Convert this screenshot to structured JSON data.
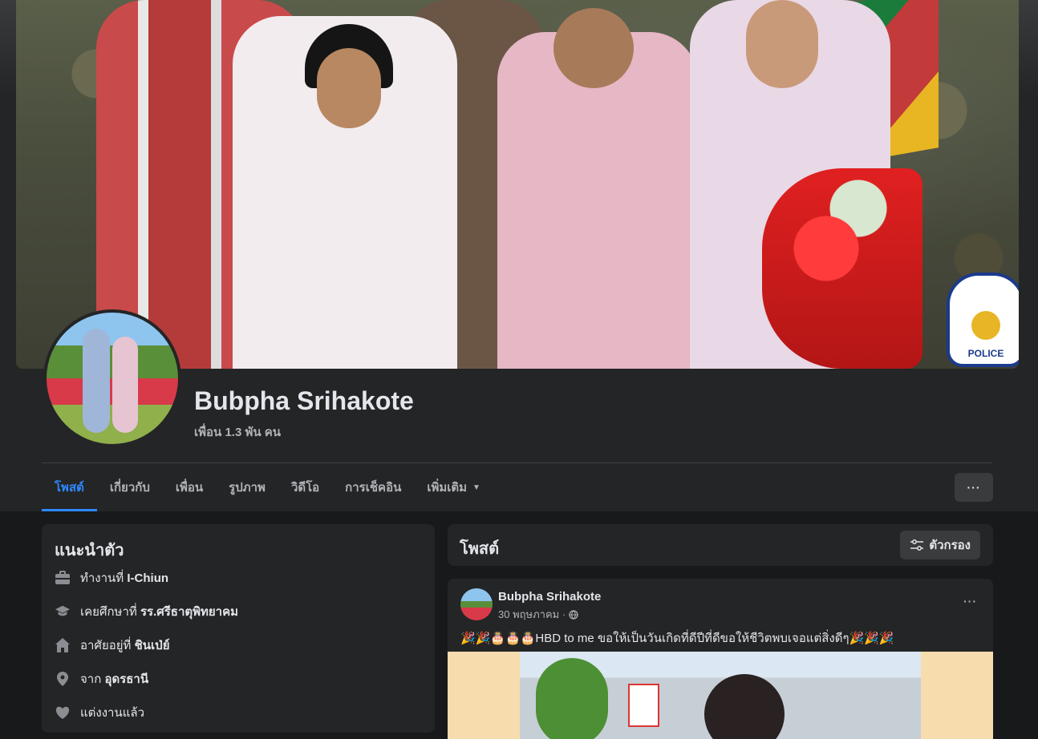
{
  "profile": {
    "name": "Bubpha Srihakote",
    "friends": "เพื่อน 1.3 พัน คน"
  },
  "cover": {
    "police_text": "POLICE"
  },
  "tabs": [
    {
      "label": "โพสต์",
      "active": true
    },
    {
      "label": "เกี่ยวกับ"
    },
    {
      "label": "เพื่อน"
    },
    {
      "label": "รูปภาพ"
    },
    {
      "label": "วิดีโอ"
    },
    {
      "label": "การเช็คอิน"
    },
    {
      "label": "เพิ่มเติม",
      "dropdown": true
    }
  ],
  "more_button": "···",
  "intro": {
    "title": "แนะนำตัว",
    "items": [
      {
        "icon": "briefcase-icon",
        "prefix": "ทำงานที่ ",
        "value": "I-Chiun"
      },
      {
        "icon": "graduation-cap-icon",
        "prefix": "เคยศึกษาที่ ",
        "value": "รร.ศรีธาตุพิทยาคม"
      },
      {
        "icon": "home-icon",
        "prefix": "อาศัยอยู่ที่ ",
        "value": "ชินเป่ย์"
      },
      {
        "icon": "location-pin-icon",
        "prefix": "จาก ",
        "value": "อุดรธานี"
      },
      {
        "icon": "heart-icon",
        "prefix": "แต่งงานแล้ว",
        "value": ""
      }
    ]
  },
  "posts": {
    "title": "โพสต์",
    "filter_label": "ตัวกรอง"
  },
  "post": {
    "author": "Bubpha Srihakote",
    "date": "30 พฤษภาคม ·",
    "text": "🎉🎉🎂🎂🎂HBD  to  me ขอให้เป็นวันเกิดที่ดีปีที่ดีขอให้ชีวิตพบเจอแต่สิ่งดีๆ🎉🎉🎉",
    "menu": "···"
  },
  "colors": {
    "accent": "#2d88ff",
    "background": "#18191a",
    "card": "#242526",
    "button": "#3a3b3c"
  }
}
